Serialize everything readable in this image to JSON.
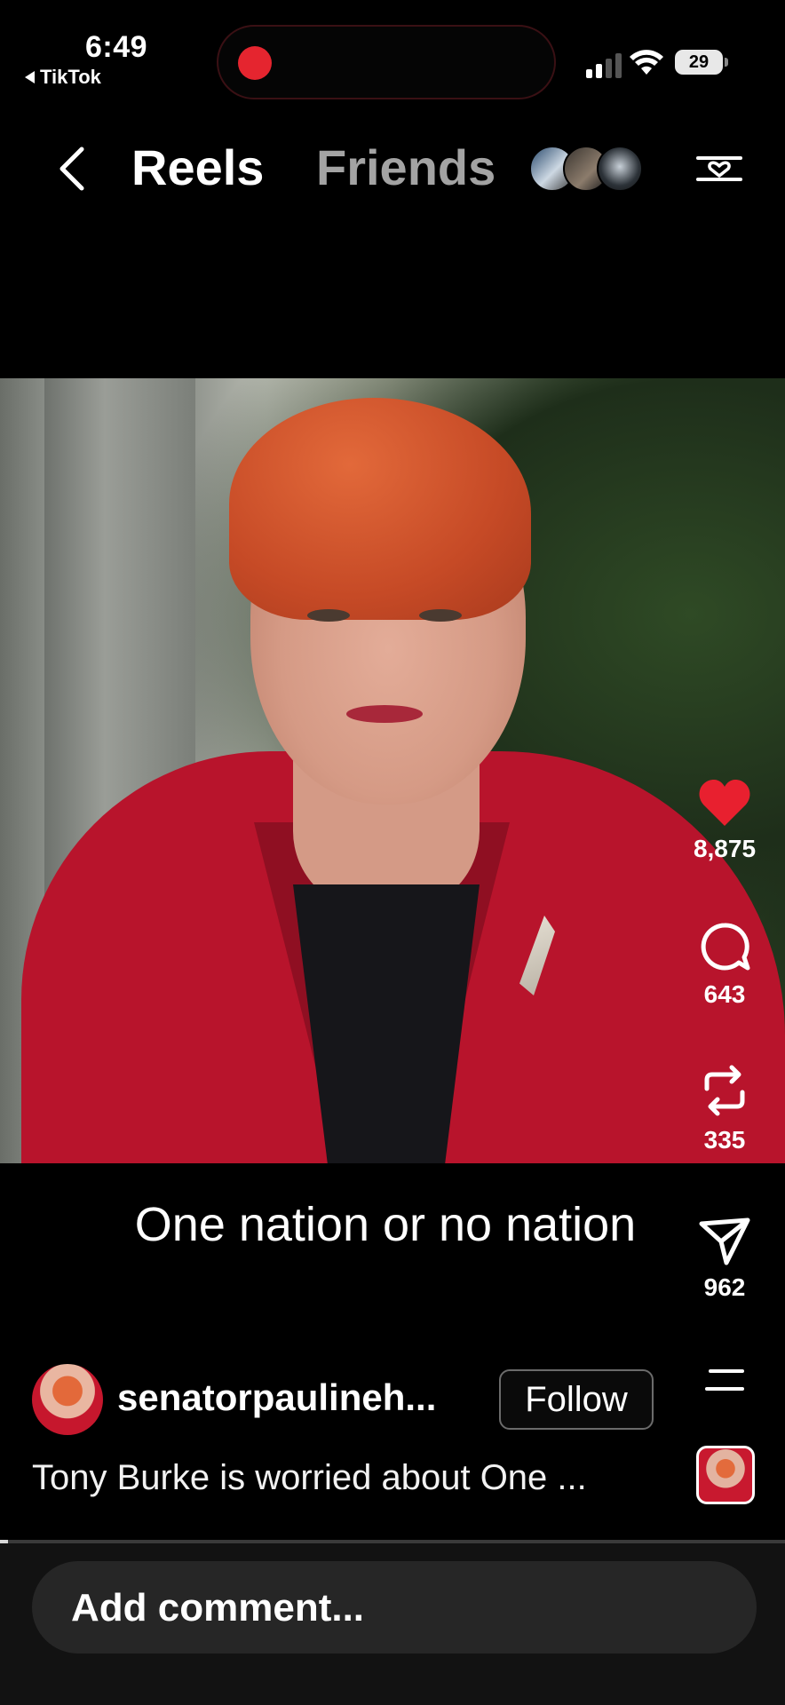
{
  "status_bar": {
    "time": "6:49",
    "back_app": "TikTok",
    "battery": "29",
    "recording_color": "#e5252f"
  },
  "nav": {
    "tabs": [
      {
        "label": "Reels",
        "active": true
      },
      {
        "label": "Friends",
        "active": false
      }
    ],
    "icons": [
      "chevron-left-icon",
      "filter-heart-icon"
    ]
  },
  "video": {
    "caption": "One nation or no nation",
    "progress": 0.01
  },
  "actions": {
    "likes": "8,875",
    "comments": "643",
    "reposts": "335",
    "shares": "962",
    "like_color": "#e8202f"
  },
  "post": {
    "username": "senatorpaulineh...",
    "follow_label": "Follow",
    "description": "Tony Burke is worried about One ..."
  },
  "comment": {
    "placeholder": "Add comment..."
  }
}
